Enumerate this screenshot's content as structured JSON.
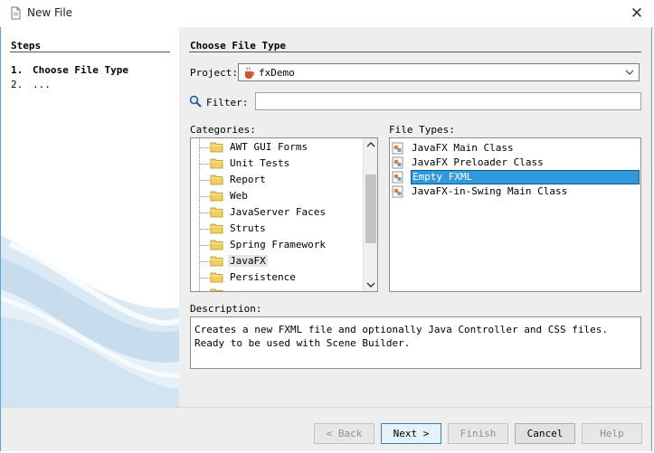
{
  "window": {
    "title": "New File",
    "close_glyph": "✕"
  },
  "steps": {
    "heading": "Steps",
    "items": [
      {
        "num": "1.",
        "label": "Choose File Type"
      },
      {
        "num": "2.",
        "label": "..."
      }
    ]
  },
  "main": {
    "heading": "Choose File Type",
    "project_label": "Project:",
    "project_value": "fxDemo",
    "filter_label": "Filter:",
    "filter_value": "",
    "categories_label": "Categories:",
    "file_types_label": "File Types:",
    "categories": [
      "AWT GUI Forms",
      "Unit Tests",
      "Report",
      "Web",
      "JavaServer Faces",
      "Struts",
      "Spring Framework",
      "JavaFX",
      "Persistence",
      "..."
    ],
    "selected_category": "JavaFX",
    "file_types": [
      "JavaFX Main Class",
      "JavaFX Preloader Class",
      "Empty FXML",
      "JavaFX-in-Swing Main Class"
    ],
    "selected_file_type": "Empty FXML",
    "description_label": "Description:",
    "description": "Creates a new FXML file and optionally Java Controller and CSS files. Ready to be used with Scene Builder."
  },
  "buttons": {
    "back": "< Back",
    "next": "Next >",
    "finish": "Finish",
    "cancel": "Cancel",
    "help": "Help"
  },
  "icons": {
    "app": "netbeans-file-icon",
    "project": "java-cup-icon",
    "filter": "magnifier-icon",
    "category": "folder-icon",
    "file_type": "fxml-file-icon"
  },
  "colors": {
    "selection": "#3399dd",
    "window_border": "#5aa6d8",
    "panel_background": "#eeeeee"
  }
}
